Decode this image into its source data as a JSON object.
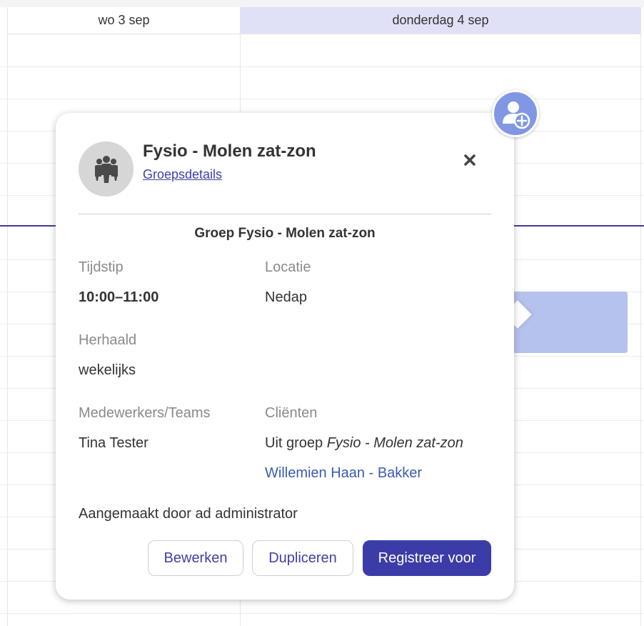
{
  "calendar": {
    "day_headers": [
      "wo 3 sep",
      "donderdag 4 sep"
    ]
  },
  "popover": {
    "title": "Fysio - Molen zat-zon",
    "group_link": "Groepsdetails",
    "close_icon": "close-icon",
    "subtitle": "Groep Fysio - Molen zat-zon",
    "time_label": "Tijdstip",
    "time_value": "10:00–11:00",
    "location_label": "Locatie",
    "location_value": "Nedap",
    "repeat_label": "Herhaald",
    "repeat_value": "wekelijks",
    "staff_label": "Medewerkers/Teams",
    "staff_value": "Tina Tester",
    "clients_label": "Cliënten",
    "clients_prefix": "Uit groep ",
    "clients_group": "Fysio - Molen zat-zon",
    "client_link": "Willemien Haan - Bakker",
    "created_by": "Aangemaakt door ad administrator",
    "buttons": {
      "edit": "Bewerken",
      "duplicate": "Dupliceren",
      "register": "Registreer voor"
    }
  },
  "icons": {
    "add_person": "add-person-icon",
    "group": "group-icon"
  },
  "colors": {
    "primary": "#3c3ca8",
    "header_highlight": "#e0e0f7",
    "event": "#b6c2ee",
    "link": "#3f3fa9",
    "client_link": "#3b5bb5",
    "avatar_button": "#8197e4"
  }
}
